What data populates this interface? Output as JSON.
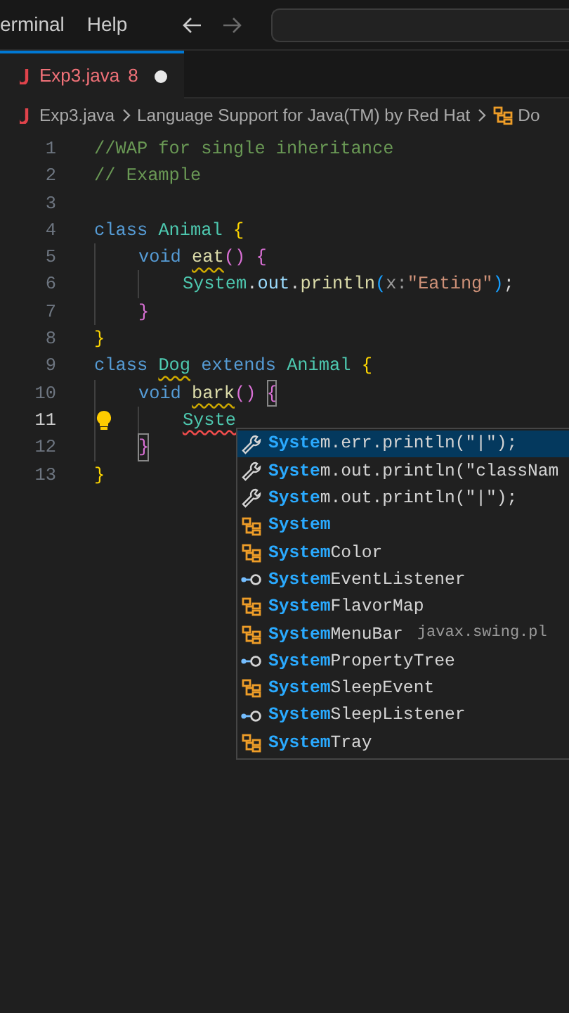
{
  "menu": [
    {
      "label": "erminal"
    },
    {
      "label": "Help"
    }
  ],
  "nav": [
    {
      "kind": "back",
      "disabled": false
    },
    {
      "kind": "forward",
      "disabled": true
    }
  ],
  "tabs": [
    {
      "label": "Exp3.java",
      "problems": "8",
      "modified": true,
      "selected": true
    }
  ],
  "breadcrumb": [
    {
      "kind": "file",
      "label": "Exp3.java"
    },
    {
      "kind": "folder",
      "label": "Language Support for Java(TM) by Red Hat"
    },
    {
      "kind": "class",
      "label": "Do"
    }
  ],
  "lines": [
    {
      "number": "1",
      "tokens": [
        {
          "text": "//WAP for single inheritance",
          "kind": "comment"
        }
      ]
    },
    {
      "number": "2",
      "tokens": [
        {
          "text": "// Example",
          "kind": "comment"
        }
      ]
    },
    {
      "number": "3"
    },
    {
      "number": "4",
      "tokens": [
        {
          "text": "class ",
          "kind": "keyword"
        },
        {
          "text": "Animal ",
          "kind": "type"
        },
        {
          "text": "{",
          "kind": "brace1"
        }
      ]
    },
    {
      "number": "5",
      "tokens": [
        {
          "text": "    void ",
          "kind": "keyword"
        },
        {
          "text": "eat",
          "kind": "func",
          "warning": true
        },
        {
          "text": "() ",
          "kind": "brace2"
        },
        {
          "text": "{",
          "kind": "brace2"
        }
      ]
    },
    {
      "number": "6",
      "tokens": [
        {
          "text": "        System",
          "kind": "type"
        },
        {
          "text": ".",
          "kind": "plain"
        },
        {
          "text": "out",
          "kind": "var"
        },
        {
          "text": ".",
          "kind": "plain"
        },
        {
          "text": "println",
          "kind": "func"
        },
        {
          "text": "(",
          "kind": "brace3"
        },
        {
          "text": "x:",
          "kind": "hint"
        },
        {
          "text": "\"Eating\"",
          "kind": "string"
        },
        {
          "text": ")",
          "kind": "brace3"
        },
        {
          "text": ";",
          "kind": "plain"
        }
      ]
    },
    {
      "number": "7",
      "tokens": [
        {
          "text": "    }",
          "kind": "brace2"
        }
      ]
    },
    {
      "number": "8",
      "tokens": [
        {
          "text": "}",
          "kind": "brace1"
        }
      ]
    },
    {
      "number": "9",
      "tokens": [
        {
          "text": "class ",
          "kind": "keyword"
        },
        {
          "text": "Dog",
          "kind": "type",
          "warning": true
        },
        {
          "text": " extends ",
          "kind": "keyword"
        },
        {
          "text": "Animal ",
          "kind": "type"
        },
        {
          "text": "{",
          "kind": "brace1"
        }
      ]
    },
    {
      "number": "10",
      "tokens": [
        {
          "text": "    void ",
          "kind": "keyword"
        },
        {
          "text": "bark",
          "kind": "func",
          "warning": true
        },
        {
          "text": "() ",
          "kind": "brace2"
        },
        {
          "text": "{",
          "kind": "brace2",
          "matched": true
        }
      ]
    },
    {
      "number": "11",
      "current": true,
      "lightbulb": true,
      "tokens": [
        {
          "text": "        Syste",
          "kind": "type",
          "error": true
        }
      ]
    },
    {
      "number": "12",
      "tokens": [
        {
          "text": "    }",
          "kind": "brace2",
          "matched": true
        }
      ]
    },
    {
      "number": "13",
      "tokens": [
        {
          "text": "}",
          "kind": "brace1"
        }
      ]
    }
  ],
  "suggestions": [
    {
      "kind": "snippet",
      "match": "Syste",
      "rest": "m.err.println(\"|\");",
      "selected": true
    },
    {
      "kind": "snippet",
      "match": "Syste",
      "rest": "m.out.println(\"classNam",
      "selected": false
    },
    {
      "kind": "snippet",
      "match": "Syste",
      "rest": "m.out.println(\"|\");",
      "selected": false
    },
    {
      "kind": "class",
      "match": "System",
      "selected": false
    },
    {
      "kind": "class",
      "match": "System",
      "rest": "Color",
      "selected": false
    },
    {
      "kind": "interface",
      "match": "System",
      "rest": "EventListener",
      "selected": false
    },
    {
      "kind": "class",
      "match": "System",
      "rest": "FlavorMap",
      "selected": false
    },
    {
      "kind": "class",
      "match": "System",
      "rest": "MenuBar",
      "detail": "javax.swing.pl",
      "selected": false
    },
    {
      "kind": "interface",
      "match": "System",
      "rest": "PropertyTree",
      "selected": false
    },
    {
      "kind": "class",
      "match": "System",
      "rest": "SleepEvent",
      "selected": false
    },
    {
      "kind": "interface",
      "match": "System",
      "rest": "SleepListener",
      "selected": false
    },
    {
      "kind": "class",
      "match": "System",
      "rest": "Tray",
      "selected": false
    }
  ]
}
